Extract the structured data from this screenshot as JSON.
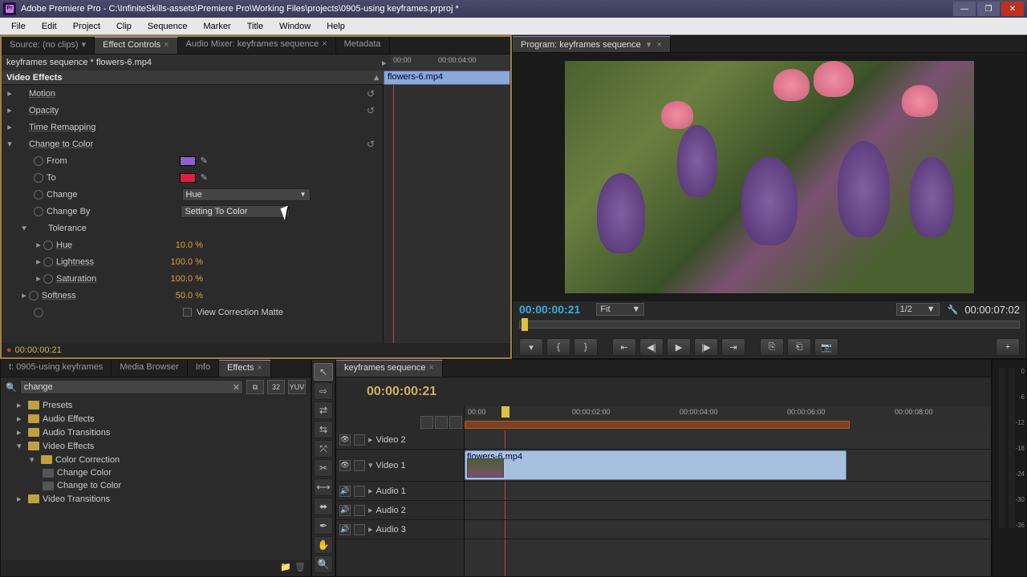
{
  "titlebar": {
    "app": "Adobe Premiere Pro",
    "path": "C:\\InfiniteSkills-assets\\Premiere Pro\\Working Files\\projects\\0905-using keyframes.prproj *",
    "logo_text": "Pr"
  },
  "menubar": [
    "File",
    "Edit",
    "Project",
    "Clip",
    "Sequence",
    "Marker",
    "Title",
    "Window",
    "Help"
  ],
  "source_tabs": {
    "items": [
      "Source: (no clips)",
      "Effect Controls",
      "Audio Mixer: keyframes sequence",
      "Metadata"
    ],
    "active": 1
  },
  "effect_controls": {
    "crumb": "keyframes sequence * flowers-6.mp4",
    "mini_times": [
      "00:00",
      "00:00:04:00"
    ],
    "clip_label": "flowers-6.mp4",
    "section": "Video Effects",
    "effects": {
      "motion": "Motion",
      "opacity": "Opacity",
      "time_remap": "Time Remapping",
      "change_to_color": {
        "name": "Change to Color",
        "from": "From",
        "to": "To",
        "change": "Change",
        "change_val": "Hue",
        "change_by": "Change By",
        "change_by_val": "Setting To Color",
        "tolerance": "Tolerance",
        "hue": "Hue",
        "hue_val": "10.0 %",
        "lightness": "Lightness",
        "lightness_val": "100.0 %",
        "saturation": "Saturation",
        "saturation_val": "100.0 %",
        "softness": "Softness",
        "softness_val": "50.0 %",
        "view_matte": "View Correction Matte"
      }
    },
    "footer_tc": "00:00:00:21"
  },
  "program": {
    "tab": "Program: keyframes sequence",
    "tc": "00:00:00:21",
    "fit": "Fit",
    "zoom": "1/2",
    "duration": "00:00:07:02"
  },
  "project_tabs": {
    "items": [
      "t: 0905-using keyframes",
      "Media Browser",
      "Info",
      "Effects"
    ],
    "active": 3
  },
  "effects_panel": {
    "search": "change",
    "chips": [
      "⧉",
      "32",
      "YUV"
    ],
    "tree": {
      "presets": "Presets",
      "audio_fx": "Audio Effects",
      "audio_tr": "Audio Transitions",
      "video_fx": "Video Effects",
      "color_corr": "Color Correction",
      "change_color": "Change Color",
      "change_to_color": "Change to Color",
      "video_tr": "Video Transitions"
    }
  },
  "timeline": {
    "tab": "keyframes sequence",
    "tc": "00:00:00:21",
    "ticks": [
      "00:00",
      "00:00:02:00",
      "00:00:04:00",
      "00:00:06:00",
      "00:00:08:00"
    ],
    "tracks": {
      "v2": "Video 2",
      "v1": "Video 1",
      "a1": "Audio 1",
      "a2": "Audio 2",
      "a3": "Audio 3"
    },
    "clip": "flowers-6.mp4"
  },
  "meters": {
    "marks": [
      "0",
      "-6",
      "-12",
      "-18",
      "-24",
      "-30",
      "-36"
    ]
  }
}
